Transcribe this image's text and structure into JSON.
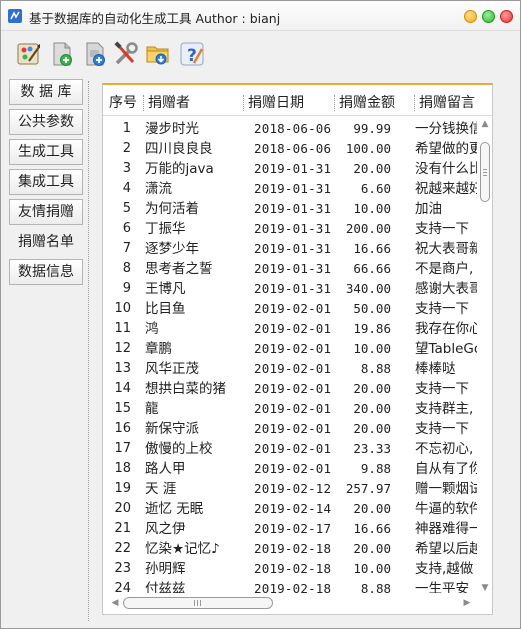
{
  "window": {
    "title": "基于数据库的自动化生成工具  Author : bianj"
  },
  "toolbar": {
    "buttons": [
      {
        "name": "paint-tool-icon"
      },
      {
        "name": "add-document-icon"
      },
      {
        "name": "add-database-icon"
      },
      {
        "name": "settings-tools-icon"
      },
      {
        "name": "folder-download-icon"
      },
      {
        "name": "help-icon"
      }
    ]
  },
  "nav": {
    "items": [
      {
        "label": "数 据 库",
        "active": false
      },
      {
        "label": "公共参数",
        "active": false
      },
      {
        "label": "生成工具",
        "active": false
      },
      {
        "label": "集成工具",
        "active": false
      },
      {
        "label": "友情捐赠",
        "active": false
      },
      {
        "label": "捐赠名单",
        "active": true
      },
      {
        "label": "数据信息",
        "active": false
      }
    ]
  },
  "table": {
    "headers": [
      "序号",
      "捐赠者",
      "捐赠日期",
      "捐赠金额",
      "捐赠留言"
    ],
    "rows": [
      {
        "no": "1",
        "name": "漫步时光",
        "date": "2018-06-06",
        "amount": "99.99",
        "msg": "一分钱换信"
      },
      {
        "no": "2",
        "name": "四川良良良",
        "date": "2018-06-06",
        "amount": "100.00",
        "msg": "希望做的更"
      },
      {
        "no": "3",
        "name": "万能的java",
        "date": "2019-01-31",
        "amount": "20.00",
        "msg": "没有什么比"
      },
      {
        "no": "4",
        "name": "潇流",
        "date": "2019-01-31",
        "amount": "6.60",
        "msg": "祝越来越好"
      },
      {
        "no": "5",
        "name": "为何活着",
        "date": "2019-01-31",
        "amount": "10.00",
        "msg": "加油"
      },
      {
        "no": "6",
        "name": "丁振华",
        "date": "2019-01-31",
        "amount": "200.00",
        "msg": "支持一下"
      },
      {
        "no": "7",
        "name": "逐梦少年",
        "date": "2019-01-31",
        "amount": "16.66",
        "msg": "祝大表哥新"
      },
      {
        "no": "8",
        "name": "思考者之誓",
        "date": "2019-01-31",
        "amount": "66.66",
        "msg": "不是商户,"
      },
      {
        "no": "9",
        "name": "王博凡",
        "date": "2019-01-31",
        "amount": "340.00",
        "msg": "感谢大表哥"
      },
      {
        "no": "10",
        "name": "比目鱼",
        "date": "2019-02-01",
        "amount": "50.00",
        "msg": "支持一下"
      },
      {
        "no": "11",
        "name": "鸿",
        "date": "2019-02-01",
        "amount": "19.86",
        "msg": "我存在你心"
      },
      {
        "no": "12",
        "name": "章鹏",
        "date": "2019-02-01",
        "amount": "10.00",
        "msg": "望TableGo"
      },
      {
        "no": "13",
        "name": "风华正茂",
        "date": "2019-02-01",
        "amount": "8.88",
        "msg": "棒棒哒"
      },
      {
        "no": "14",
        "name": "想拱白菜的猪",
        "date": "2019-02-01",
        "amount": "20.00",
        "msg": "支持一下"
      },
      {
        "no": "15",
        "name": "龍",
        "date": "2019-02-01",
        "amount": "20.00",
        "msg": "支持群主,"
      },
      {
        "no": "16",
        "name": "新保守派",
        "date": "2019-02-01",
        "amount": "20.00",
        "msg": "支持一下"
      },
      {
        "no": "17",
        "name": "傲慢的上校",
        "date": "2019-02-01",
        "amount": "23.33",
        "msg": "不忘初心,"
      },
      {
        "no": "18",
        "name": "路人甲",
        "date": "2019-02-01",
        "amount": "9.88",
        "msg": "自从有了你"
      },
      {
        "no": "19",
        "name": "天  涯",
        "date": "2019-02-12",
        "amount": "257.97",
        "msg": "赠一颗烟试"
      },
      {
        "no": "20",
        "name": "逝忆  无眠",
        "date": "2019-02-14",
        "amount": "20.00",
        "msg": "牛逼的软件"
      },
      {
        "no": "21",
        "name": "风之伊",
        "date": "2019-02-17",
        "amount": "16.66",
        "msg": "神器难得一"
      },
      {
        "no": "22",
        "name": "忆染★记忆♪",
        "date": "2019-02-18",
        "amount": "20.00",
        "msg": "希望以后越"
      },
      {
        "no": "23",
        "name": "孙明辉",
        "date": "2019-02-18",
        "amount": "10.00",
        "msg": "支持,越做"
      },
      {
        "no": "24",
        "name": "付兹兹",
        "date": "2019-02-18",
        "amount": "8.88",
        "msg": "一生平安"
      }
    ]
  },
  "colors": {
    "accent": "#f0a83a",
    "window_bg": "#f0f0f0"
  }
}
